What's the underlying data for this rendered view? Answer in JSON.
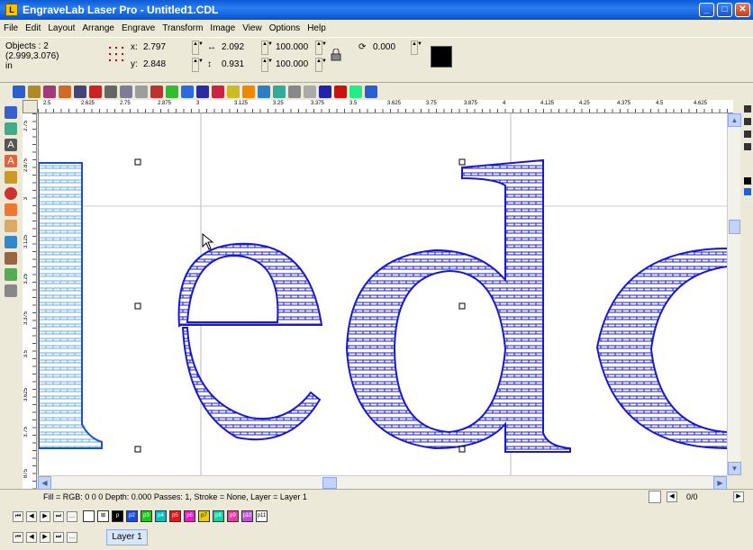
{
  "window": {
    "title": "EngraveLab Laser Pro - Untitled1.CDL",
    "app_icon": "L"
  },
  "menu": [
    "File",
    "Edit",
    "Layout",
    "Arrange",
    "Engrave",
    "Transform",
    "Image",
    "View",
    "Options",
    "Help"
  ],
  "props": {
    "objects_line1": "Objects : 2",
    "objects_line2": "(2.999,3.076)",
    "units": "in",
    "x_label": "x:",
    "x_value": "2.797",
    "y_label": "y:",
    "y_value": "2.848",
    "w_value": "2.092",
    "h_value": "0.931",
    "sx_value": "100.000",
    "sy_value": "100.000",
    "rotate_value": "0.000"
  },
  "ruler_top": [
    "2.5",
    "2.625",
    "2.75",
    "2.875",
    "3",
    "3.125",
    "3.25",
    "3.375",
    "3.5",
    "3.625",
    "3.75",
    "3.875",
    "4",
    "4.125",
    "4.25",
    "4.375",
    "4.5",
    "4.625"
  ],
  "ruler_left": [
    "2.75",
    "2.875",
    "3",
    "3.125",
    "3.25",
    "3.375",
    "3.5",
    "3.625",
    "3.75",
    "875"
  ],
  "status": {
    "text": "Fill = RGB: 0 0 0 Depth: 0.000 Passes: 1, Stroke = None, Layer = Layer 1",
    "page": "0/0"
  },
  "pens": [
    "",
    "p",
    "p2",
    "p3",
    "p4",
    "p5",
    "p6",
    "p7",
    "p8",
    "p9",
    "p10",
    "p11"
  ],
  "layer": {
    "tab": "Layer 1"
  },
  "colors": {
    "title_blue": "#0a5bd6",
    "outline_blue": "#1a1acc",
    "fill_blue": "#62a8e8"
  }
}
